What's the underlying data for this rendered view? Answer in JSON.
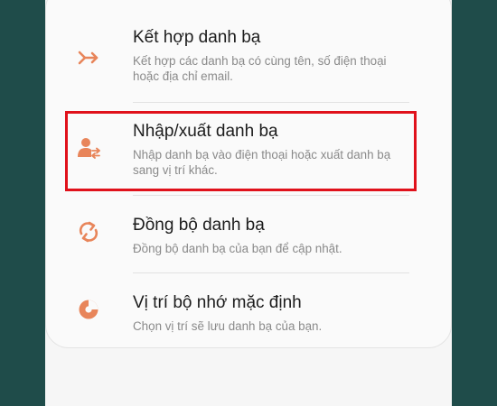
{
  "accent_color": "#e8855a",
  "highlight_color": "#e0111b",
  "items": [
    {
      "icon": "merge-arrow-icon",
      "title": "Kết hợp danh bạ",
      "description": "Kết hợp các danh bạ có cùng tên, số điện thoại hoặc địa chỉ email."
    },
    {
      "icon": "contact-import-export-icon",
      "title": "Nhập/xuất danh bạ",
      "description": "Nhập danh bạ vào điện thoại hoặc xuất danh bạ sang vị trí khác."
    },
    {
      "icon": "sync-icon",
      "title": "Đồng bộ danh bạ",
      "description": "Đồng bộ danh bạ của bạn để cập nhật."
    },
    {
      "icon": "storage-pie-icon",
      "title": "Vị trí bộ nhớ mặc định",
      "description": "Chọn vị trí sẽ lưu danh bạ của bạn."
    }
  ]
}
